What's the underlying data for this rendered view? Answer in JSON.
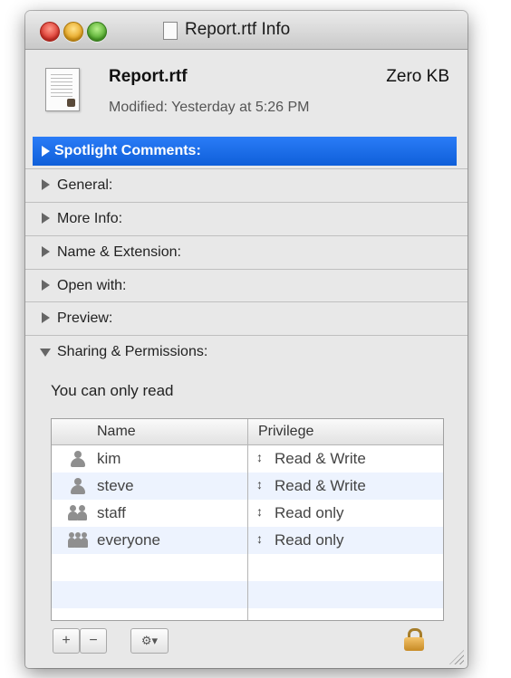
{
  "window": {
    "title": "Report.rtf Info"
  },
  "file": {
    "name": "Report.rtf",
    "size": "Zero KB",
    "modified": "Modified: Yesterday at 5:26 PM"
  },
  "sections": [
    {
      "label": "Spotlight Comments:",
      "expanded": false,
      "selected": true
    },
    {
      "label": "General:",
      "expanded": false
    },
    {
      "label": "More Info:",
      "expanded": false
    },
    {
      "label": "Name & Extension:",
      "expanded": false
    },
    {
      "label": "Open with:",
      "expanded": false
    },
    {
      "label": "Preview:",
      "expanded": false
    },
    {
      "label": "Sharing & Permissions:",
      "expanded": true
    }
  ],
  "sharing": {
    "status_text": "You can only read",
    "columns": {
      "name": "Name",
      "privilege": "Privilege"
    },
    "rows": [
      {
        "name": "kim",
        "privilege": "Read & Write",
        "icon": "user-icon"
      },
      {
        "name": "steve",
        "privilege": "Read & Write",
        "icon": "user-icon"
      },
      {
        "name": "staff",
        "privilege": "Read only",
        "icon": "group-icon"
      },
      {
        "name": "everyone",
        "privilege": "Read only",
        "icon": "everyone-icon"
      }
    ],
    "stepper_glyph": "↕"
  },
  "footer": {
    "add_label": "+",
    "remove_label": "−",
    "action_label": "⚙▾"
  },
  "colors": {
    "selection": "#1a6de8",
    "alt_row": "#edf3fe",
    "lock": "#d9a441"
  }
}
